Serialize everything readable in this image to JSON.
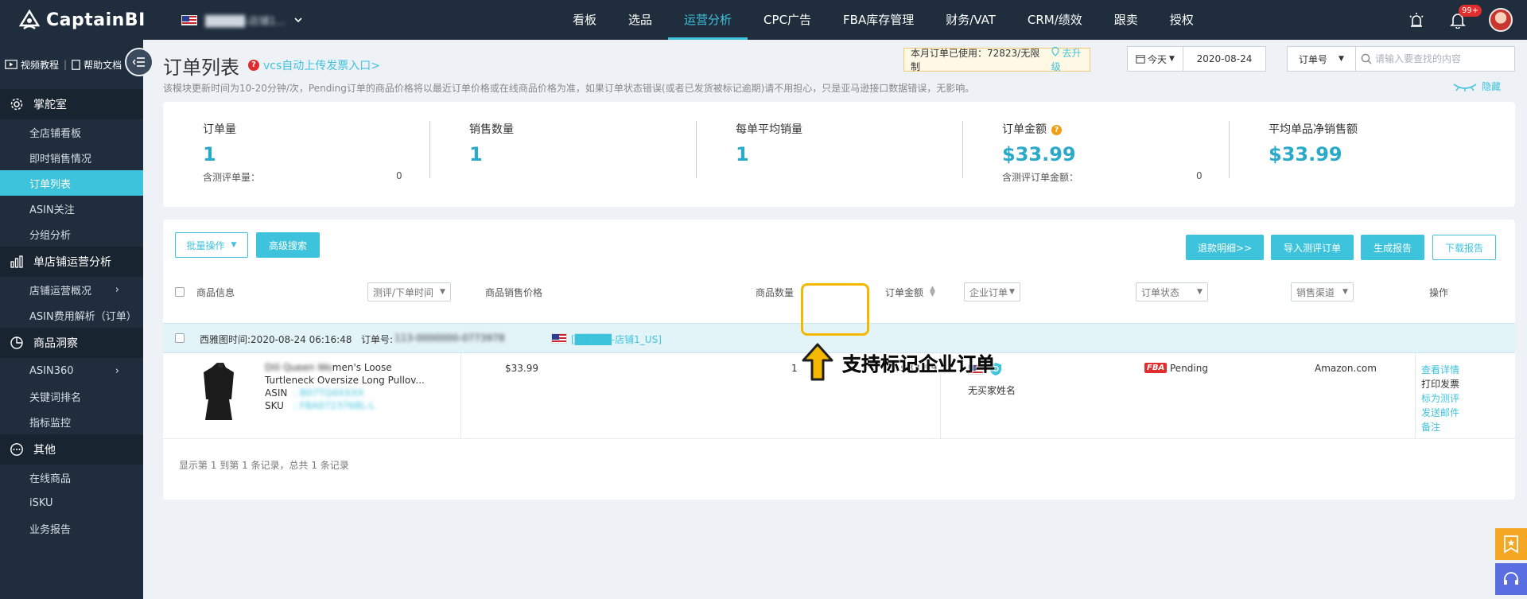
{
  "brand": {
    "name": "CaptainBI"
  },
  "store": {
    "name": "█████-店铺1..."
  },
  "nav": [
    {
      "label": "看板"
    },
    {
      "label": "选品"
    },
    {
      "label": "运营分析"
    },
    {
      "label": "CPC广告"
    },
    {
      "label": "FBA库存管理"
    },
    {
      "label": "财务/VAT"
    },
    {
      "label": "CRM/绩效"
    },
    {
      "label": "跟卖"
    },
    {
      "label": "授权"
    }
  ],
  "notifications": {
    "badge": "99+"
  },
  "sidebar": {
    "video_tutorial": "视频教程",
    "help_doc": "帮助文档",
    "groups": [
      {
        "label": "掌舵室",
        "items": [
          "全店铺看板",
          "即时销售情况",
          "订单列表",
          "ASIN关注",
          "分组分析"
        ]
      },
      {
        "label": "单店铺运营分析",
        "items": [
          "店铺运营概况",
          "ASIN费用解析（订单）"
        ]
      },
      {
        "label": "商品洞察",
        "items": [
          "ASIN360",
          "关键词排名",
          "指标监控"
        ]
      },
      {
        "label": "其他",
        "items": [
          "在线商品",
          "iSKU",
          "业务报告"
        ]
      }
    ]
  },
  "page": {
    "title": "订单列表",
    "vcs_link": "vcs自动上传发票入口>",
    "usage_text": "本月订单已使用：72823/无限制",
    "upgrade": "去升级",
    "today": "今天",
    "date": "2020-08-24",
    "search_field": "订单号",
    "search_placeholder": "请输入要查找的内容",
    "notice": "该模块更新时间为10-20分钟/次，Pending订单的商品价格将以最近订单价格或在线商品价格为准，如果订单状态错误(或者已发货被标记逾期)请不用担心，只是亚马逊接口数据错误，无影响。",
    "hide": "隐藏"
  },
  "stats": [
    {
      "label": "订单量",
      "value": "1",
      "sub": "含测评单量：",
      "subval": "0"
    },
    {
      "label": "销售数量",
      "value": "1"
    },
    {
      "label": "每单平均销量",
      "value": "1"
    },
    {
      "label": "订单金额",
      "value": "$33.99",
      "sub": "含测评订单金额：",
      "subval": "0"
    },
    {
      "label": "平均单品净销售额",
      "value": "$33.99"
    }
  ],
  "toolbar": {
    "batch": "批量操作",
    "advanced": "高级搜索",
    "refund": "退款明细>>",
    "import": "导入测评订单",
    "generate": "生成报告",
    "download": "下载报告"
  },
  "columns": {
    "product": "商品信息",
    "review": "测评/下单时间",
    "price": "商品销售价格",
    "qty": "商品数量",
    "amount": "订单金额",
    "business": "企业订单",
    "status": "订单状态",
    "channel": "销售渠道",
    "ops": "操作"
  },
  "order": {
    "time": "西雅图时间:2020-08-24 06:16:48",
    "order_no_label": "订单号:",
    "order_no": "113-0000000-0773978",
    "store": "[█████-店铺1_US]",
    "title_blur": "Dili Queen Wo",
    "title_1": "men's Loose",
    "title_2": "Turtleneck Oversize Long Pullov...",
    "asin_label": "ASIN",
    "asin": ": B07TQ4XXXX",
    "sku_label": "SKU",
    "sku": ": FBA0723768L-L",
    "price": "$33.99",
    "qty": "1",
    "amount": "$33.99",
    "buyer": "无买家姓名",
    "fba": "FBA",
    "status": "Pending",
    "channel": "Amazon.com",
    "actions": [
      "查看详情",
      "打印发票",
      "标为测评",
      "发送邮件",
      "备注"
    ]
  },
  "footer": "显示第 1 到第 1 条记录，总共 1 条记录",
  "callout": "支持标记企业订单",
  "colors": {
    "accent": "#3ec3dd",
    "sidebar": "#1f2d3d",
    "highlight": "#f5b800"
  }
}
